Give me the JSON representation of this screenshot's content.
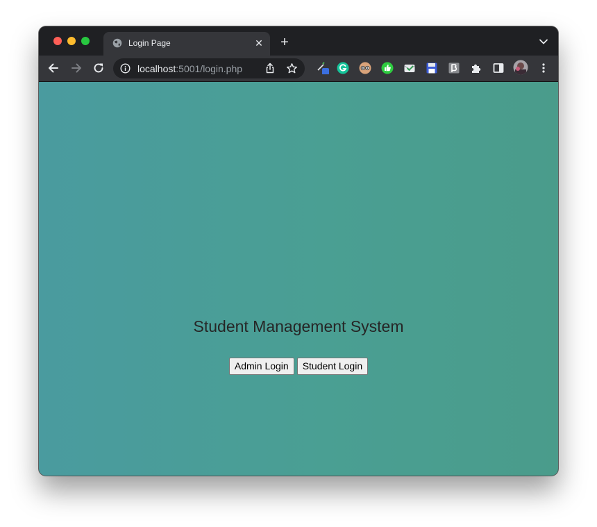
{
  "browser": {
    "tab": {
      "title": "Login Page",
      "close_glyph": "✕"
    },
    "new_tab_glyph": "+",
    "address": {
      "host": "localhost",
      "path": ":5001/login.php"
    },
    "icons": {
      "favicon": "globe-icon",
      "back": "back-arrow-icon",
      "forward": "forward-arrow-icon",
      "reload": "reload-icon",
      "info": "info-icon",
      "share": "share-icon",
      "bookmark": "star-icon",
      "extensions": [
        "color-picker-extension-icon",
        "grammarly-extension-icon",
        "glasses-extension-icon",
        "thumbs-up-extension-icon",
        "mail-check-extension-icon",
        "save-extension-icon",
        "beta-extension-icon",
        "puzzle-icon"
      ],
      "side_panel": "side-panel-icon",
      "profile": "profile-avatar",
      "menu": "more-vert-icon"
    },
    "colors": {
      "frame": "#1f2023",
      "toolbar": "#35363a",
      "omnibox": "#202124"
    }
  },
  "page": {
    "title": "Student Management System",
    "buttons": {
      "admin_login": "Admin Login",
      "student_login": "Student Login"
    },
    "colors": {
      "background_left": "#4a9b9f",
      "background_right": "#4a9c8b",
      "title_text": "#262626"
    }
  }
}
